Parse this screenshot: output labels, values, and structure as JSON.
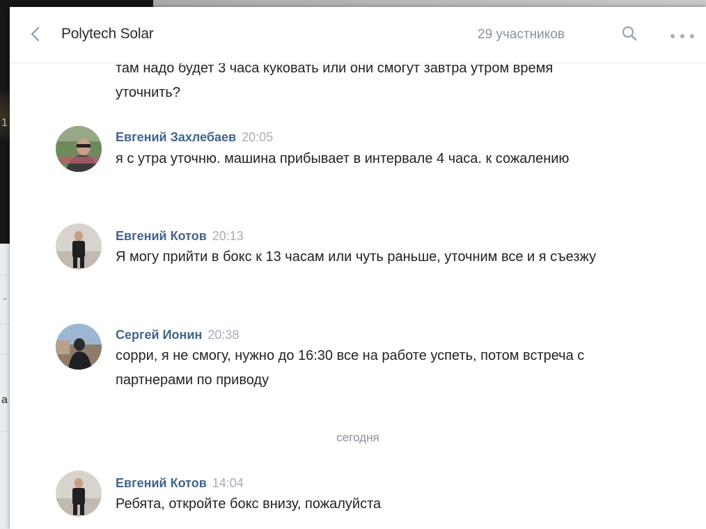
{
  "background": {
    "left_fragment_1": "1",
    "left_fragment_2": "а"
  },
  "header": {
    "title": "Polytech Solar",
    "members": "29 участников",
    "icons": {
      "back": "chevron-left-icon",
      "search": "search-icon",
      "more": "more-dots-icon"
    }
  },
  "colors": {
    "author": "#42648b",
    "time": "#a6adb6",
    "text": "#222222",
    "muted": "#8a9099"
  },
  "messages": [
    {
      "text": "там надо будет 3 часа куковать или они смогут завтра утром время уточнить?"
    },
    {
      "author": "Евгений Захлебаев",
      "time": "20:05",
      "text": "я с утра уточню. машина прибывает в интервале 4 часа. к сожалению"
    },
    {
      "author": "Евгений Котов",
      "time": "20:13",
      "text": "Я могу прийти в бокс к 13 часам или чуть раньше, уточним все и я съезжу"
    },
    {
      "author": "Сергей Ионин",
      "time": "20:38",
      "text": "сорри, я не смогу, нужно до 16:30 все на работе успеть, потом встреча с партнерами по приводу"
    },
    {
      "author": "Евгений Котов",
      "time": "14:04",
      "text": "Ребята, откройте бокс внизу, пожалуйста"
    }
  ],
  "date_separator": "сегодня"
}
